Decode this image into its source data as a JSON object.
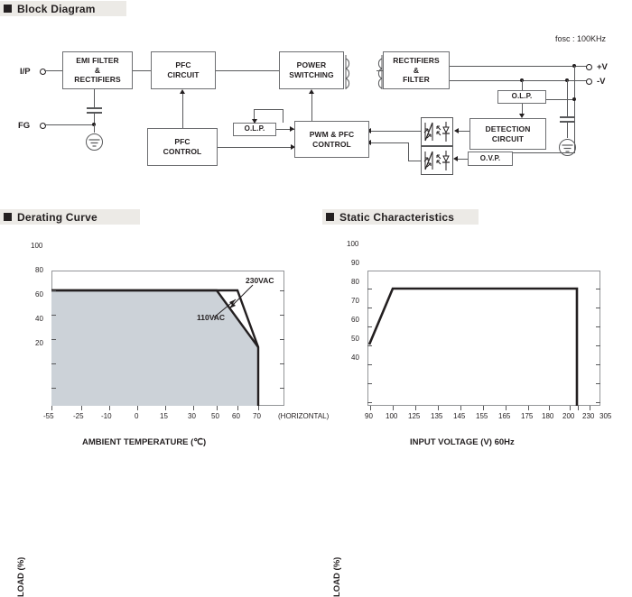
{
  "sections": {
    "block_diagram": {
      "title": "Block Diagram",
      "note": "fosc : 100KHz"
    },
    "derating": {
      "title": "Derating Curve"
    },
    "static": {
      "title": "Static Characteristics"
    }
  },
  "block_diagram": {
    "input_terminals": [
      {
        "name": "ip-terminal",
        "label": "I/P"
      },
      {
        "name": "fg-terminal",
        "label": "FG"
      }
    ],
    "output_terminals": [
      {
        "name": "positive-output-terminal",
        "label": "+V"
      },
      {
        "name": "negative-output-terminal",
        "label": "-V"
      }
    ],
    "blocks": [
      {
        "name": "emi-filter-rectifiers-block",
        "label": "EMI FILTER\n&\nRECTIFIERS"
      },
      {
        "name": "pfc-circuit-block",
        "label": "PFC\nCIRCUIT"
      },
      {
        "name": "power-switching-block",
        "label": "POWER\nSWITCHING"
      },
      {
        "name": "rectifiers-filter-block",
        "label": "RECTIFIERS\n&\nFILTER"
      },
      {
        "name": "pfc-control-block",
        "label": "PFC\nCONTROL"
      },
      {
        "name": "olp-primary-block",
        "label": "O.L.P."
      },
      {
        "name": "pwm-pfc-control-block",
        "label": "PWM & PFC\nCONTROL"
      },
      {
        "name": "olp-secondary-block",
        "label": "O.L.P."
      },
      {
        "name": "detection-circuit-block",
        "label": "DETECTION\nCIRCUIT"
      },
      {
        "name": "ovp-block",
        "label": "O.V.P."
      }
    ]
  },
  "chart_data": [
    {
      "type": "line",
      "name": "derating-curve",
      "title": "Derating Curve",
      "xlabel": "AMBIENT TEMPERATURE (℃)",
      "ylabel": "LOAD (%)",
      "xticks": [
        "-55",
        "-25",
        "-10",
        "0",
        "15",
        "30",
        "50",
        "60",
        "70"
      ],
      "xtick_values": [
        -55,
        -25,
        -10,
        0,
        15,
        30,
        50,
        60,
        70
      ],
      "yticks": [
        "20",
        "40",
        "60",
        "80",
        "100"
      ],
      "ytick_values": [
        20,
        40,
        60,
        80,
        100
      ],
      "xlim": [
        -55,
        75
      ],
      "ylim": [
        0,
        110
      ],
      "grid": false,
      "axis_note": "(HORIZONTAL)",
      "series": [
        {
          "name": "110VAC",
          "label": "110VAC",
          "points": [
            [
              -55,
              100
            ],
            [
              50,
              100
            ],
            [
              70,
              60
            ],
            [
              70,
              0
            ]
          ]
        },
        {
          "name": "230VAC",
          "label": "230VAC",
          "points": [
            [
              -55,
              100
            ],
            [
              60,
              100
            ],
            [
              70,
              60
            ],
            [
              70,
              0
            ]
          ]
        }
      ],
      "shaded_region": "area under 110VAC curve",
      "shade_color": "#ccd2d8"
    },
    {
      "type": "line",
      "name": "static-characteristics",
      "title": "Static Characteristics",
      "xlabel": "INPUT VOLTAGE (V) 60Hz",
      "ylabel": "LOAD (%)",
      "xticks": [
        "90",
        "100",
        "125",
        "135",
        "145",
        "155",
        "165",
        "175",
        "180",
        "200",
        "230",
        "305"
      ],
      "xtick_values": [
        90,
        100,
        125,
        135,
        145,
        155,
        165,
        175,
        180,
        200,
        230,
        305
      ],
      "yticks": [
        "40",
        "50",
        "60",
        "70",
        "80",
        "90",
        "100"
      ],
      "ytick_values": [
        40,
        50,
        60,
        70,
        80,
        90,
        100
      ],
      "xlim": [
        90,
        320
      ],
      "ylim": [
        30,
        108
      ],
      "grid": false,
      "series": [
        {
          "name": "load-vs-input-voltage",
          "label": "",
          "points": [
            [
              90,
              80
            ],
            [
              100,
              100
            ],
            [
              305,
              100
            ],
            [
              305,
              30
            ]
          ]
        }
      ]
    }
  ]
}
